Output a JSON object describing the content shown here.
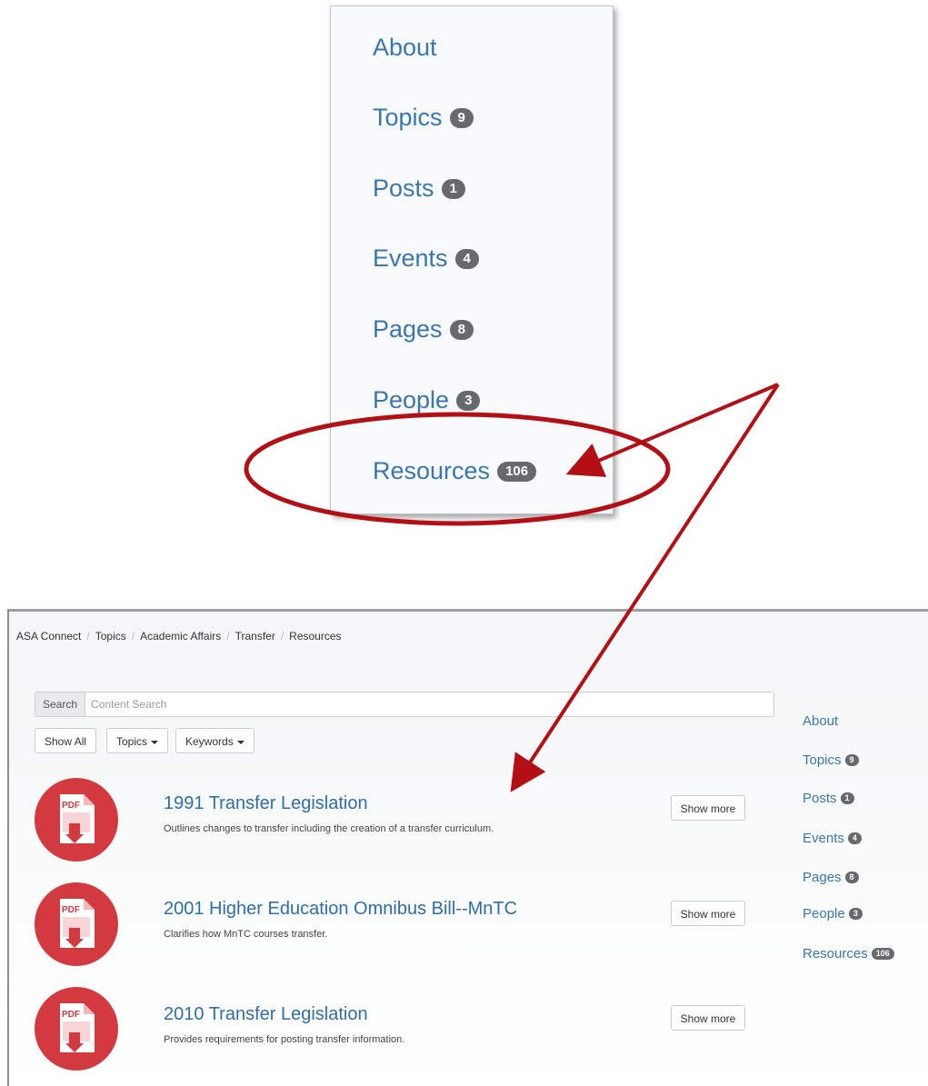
{
  "zoom_menu": {
    "items": [
      {
        "label": "About",
        "count": ""
      },
      {
        "label": "Topics",
        "count": "9"
      },
      {
        "label": "Posts",
        "count": "1"
      },
      {
        "label": "Events",
        "count": "4"
      },
      {
        "label": "Pages",
        "count": "8"
      },
      {
        "label": "People",
        "count": "3"
      },
      {
        "label": "Resources",
        "count": "106"
      }
    ]
  },
  "breadcrumb": [
    "ASA Connect",
    "Topics",
    "Academic Affairs",
    "Transfer",
    "Resources"
  ],
  "search": {
    "label": "Search",
    "placeholder": "Content Search",
    "value": ""
  },
  "filters": {
    "show_all": "Show All",
    "topics": "Topics",
    "keywords": "Keywords"
  },
  "resources": [
    {
      "title": "1991 Transfer Legislation",
      "description": "Outlines changes to transfer including the creation of a transfer curriculum.",
      "button": "Show more",
      "icon_label": "PDF"
    },
    {
      "title": "2001 Higher Education Omnibus Bill--MnTC",
      "description": "Clarifies how MnTC courses transfer.",
      "button": "Show more",
      "icon_label": "PDF"
    },
    {
      "title": "2010 Transfer Legislation",
      "description": "Provides requirements for posting transfer information.",
      "button": "Show more",
      "icon_label": "PDF"
    }
  ],
  "sidebar": {
    "items": [
      {
        "label": "About",
        "count": ""
      },
      {
        "label": "Topics",
        "count": "9"
      },
      {
        "label": "Posts",
        "count": "1"
      },
      {
        "label": "Events",
        "count": "4"
      },
      {
        "label": "Pages",
        "count": "8"
      },
      {
        "label": "People",
        "count": "3"
      },
      {
        "label": "Resources",
        "count": "106"
      }
    ]
  },
  "colors": {
    "link": "#3a77ae",
    "badge": "#666a6d",
    "annotation": "#b30f14",
    "pdf_icon": "#d23a3f"
  }
}
